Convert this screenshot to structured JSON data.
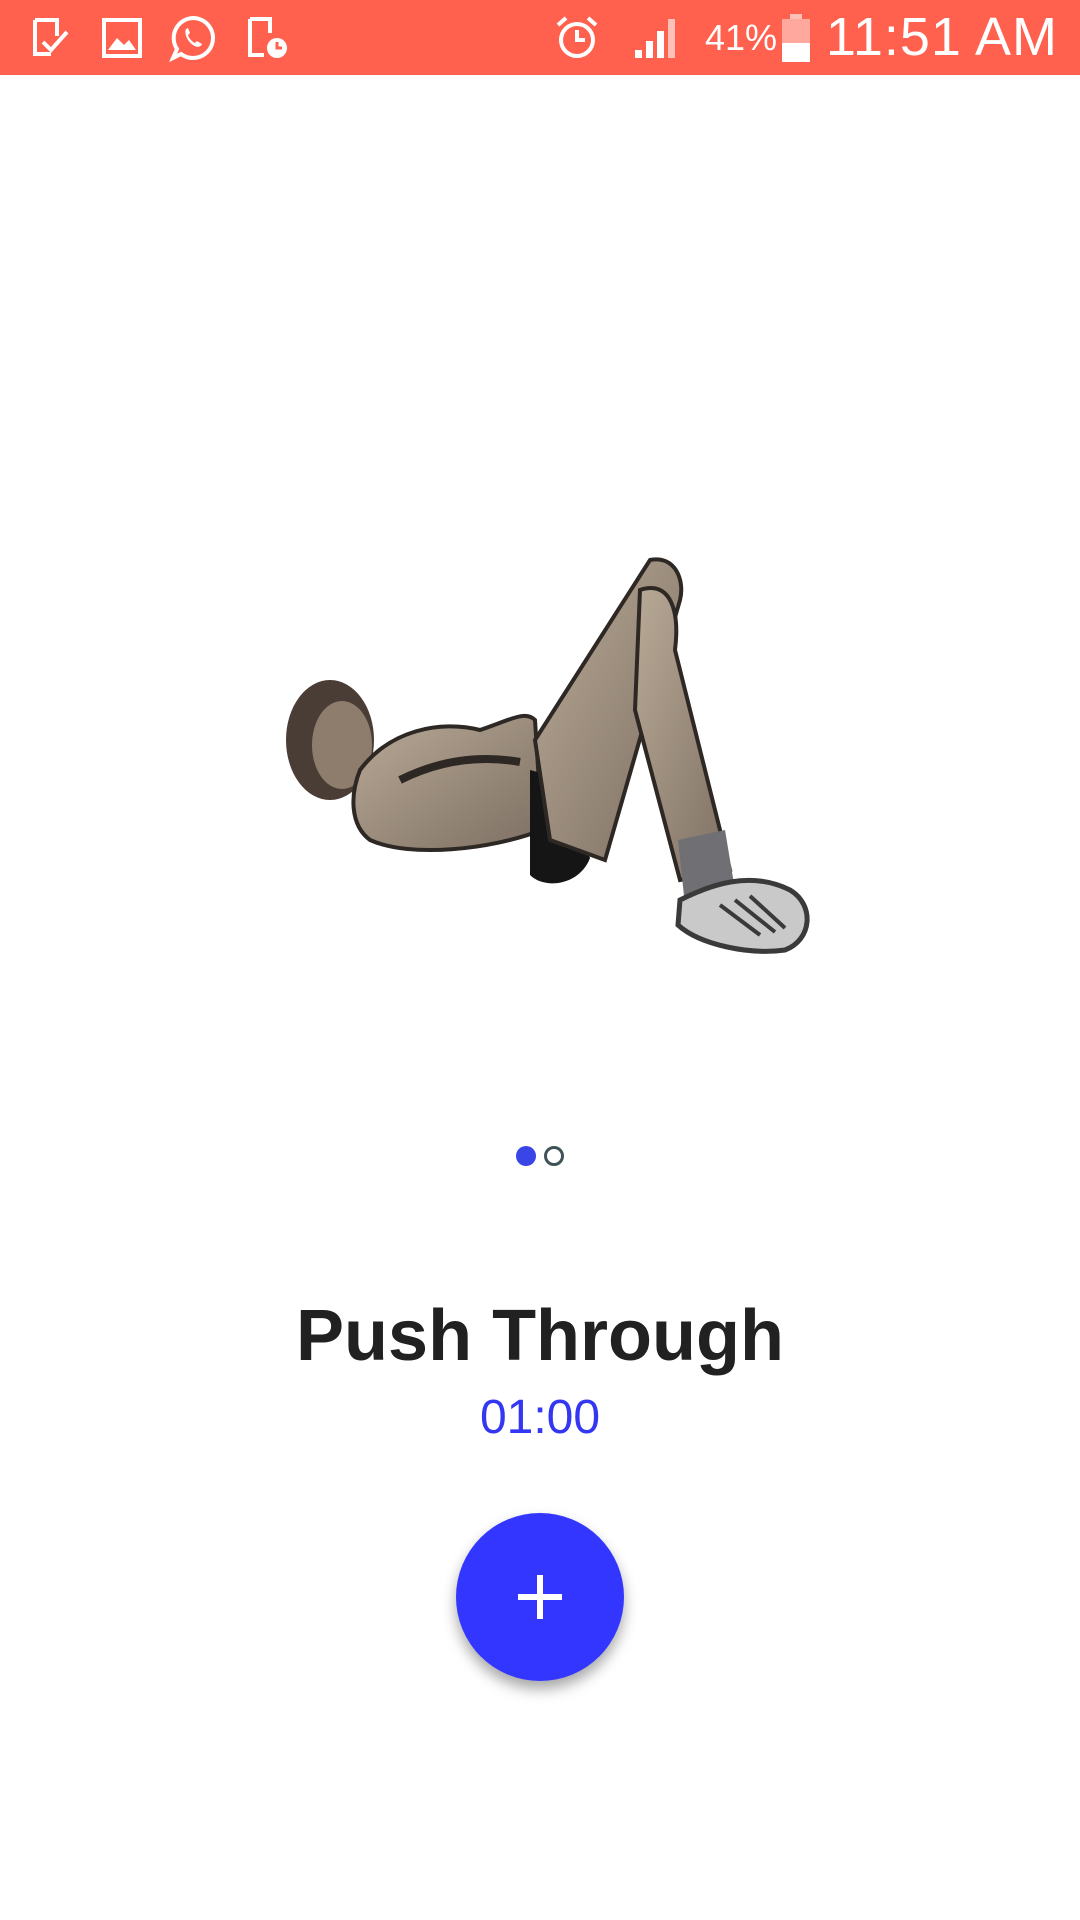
{
  "status_bar": {
    "background": "#ff614e",
    "left_icons": [
      "download-done-icon",
      "image-icon",
      "whatsapp-icon",
      "device-clock-icon"
    ],
    "right_icons": [
      "alarm-icon",
      "signal-icon",
      "battery-icon"
    ],
    "battery_percent": "41%",
    "time": "11:51 AM"
  },
  "exercise": {
    "illustration": "crunch-exercise-figure",
    "pager": {
      "count": 2,
      "active_index": 0
    },
    "name": "Push Through",
    "duration": "01:00"
  },
  "fab": {
    "icon": "plus-icon",
    "color": "#3336ff"
  },
  "colors": {
    "accent": "#3336ff",
    "timer": "#3336f2",
    "title": "#212121"
  }
}
